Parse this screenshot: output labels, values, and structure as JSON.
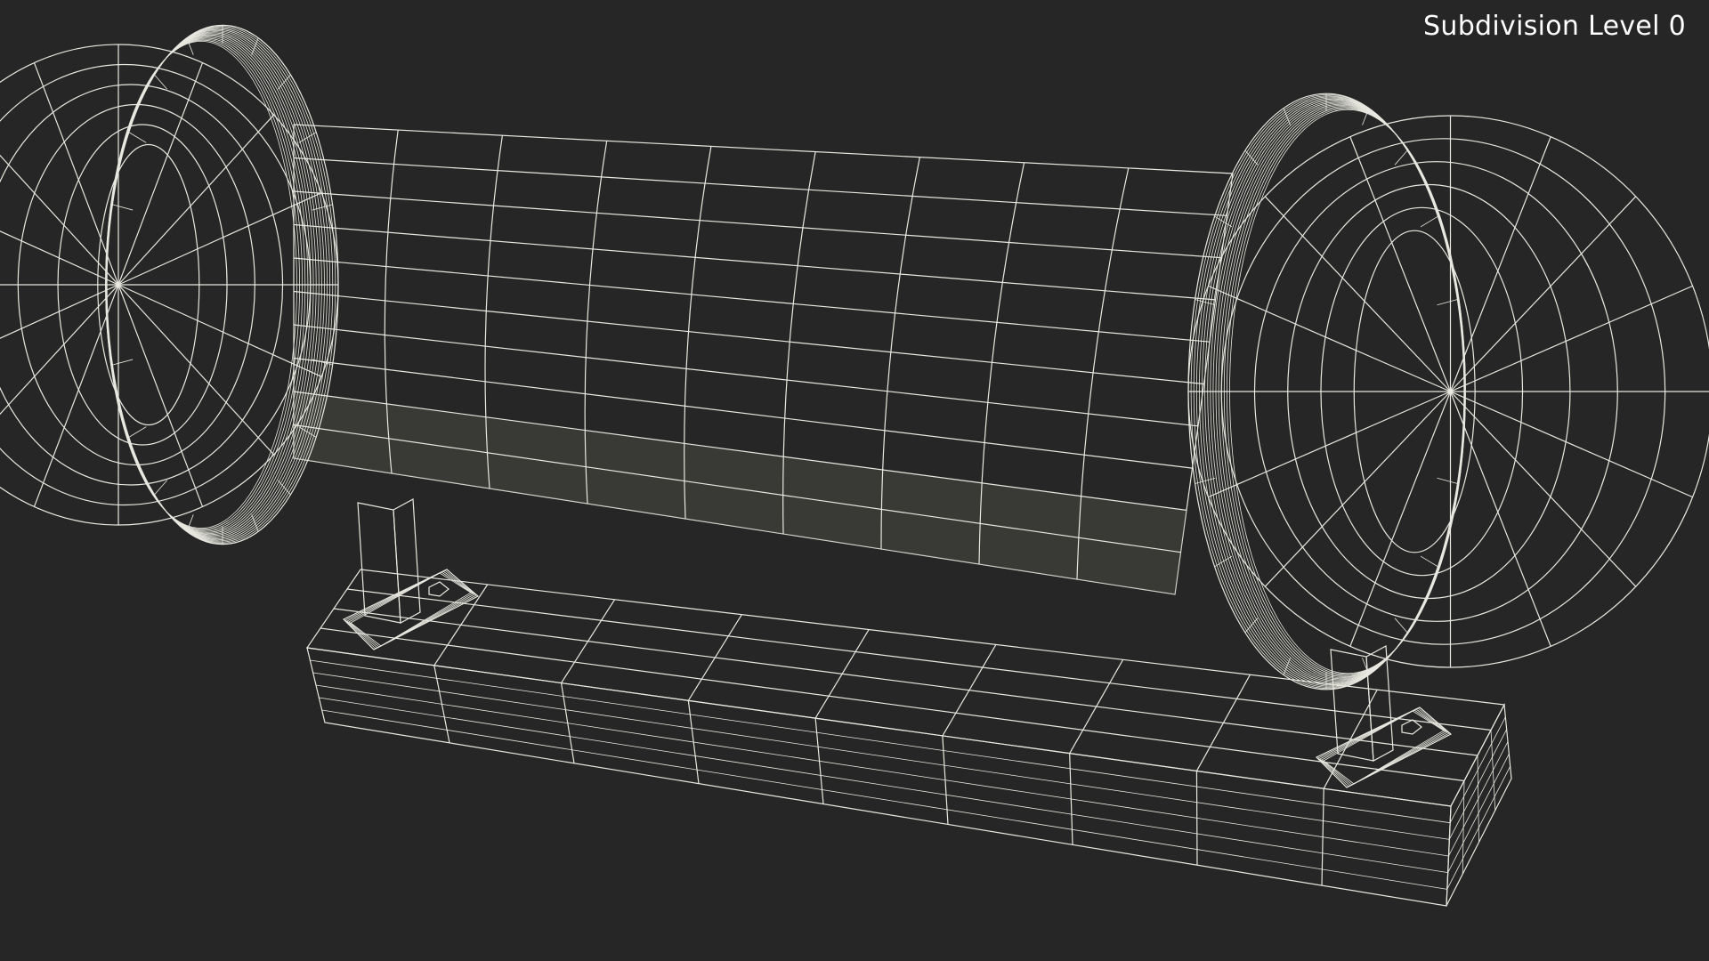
{
  "viewport": {
    "overlay_label": "Subdivision Level 0"
  },
  "model": {
    "render_mode": "wireframe-on-shaded",
    "colors": {
      "background": "#262626",
      "shell_fill": "#7b7b6e",
      "shell_shadow": "#5f5f55",
      "base_top": "#5d5d53",
      "base_side": "#4f4f47",
      "wire": "#e8e8e0"
    }
  }
}
